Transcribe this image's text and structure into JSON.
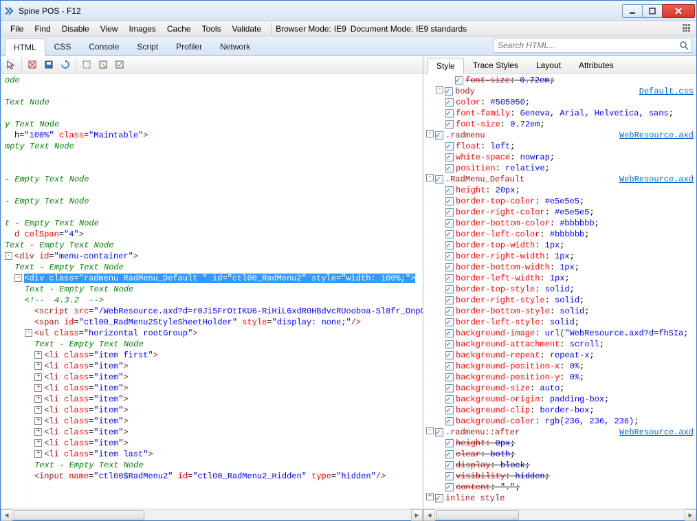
{
  "window": {
    "title": "Spine POS - F12"
  },
  "menubar": {
    "items": [
      "File",
      "Find",
      "Disable",
      "View",
      "Images",
      "Cache",
      "Tools",
      "Validate"
    ],
    "browser_mode_label": "Browser Mode:",
    "browser_mode_value": "IE9",
    "doc_mode_label": "Document Mode:",
    "doc_mode_value": "IE9 standards"
  },
  "tabs": {
    "items": [
      "HTML",
      "CSS",
      "Console",
      "Script",
      "Profiler",
      "Network"
    ],
    "active": "HTML",
    "search_placeholder": "Search HTML..."
  },
  "subtabs": {
    "items": [
      "Style",
      "Trace Styles",
      "Layout",
      "Attributes"
    ],
    "active": "Style"
  },
  "code_lines": [
    {
      "indent": 0,
      "type": "txt",
      "text": "ode"
    },
    {
      "indent": 0,
      "type": "blank"
    },
    {
      "indent": 0,
      "type": "txt",
      "text": "Text Node"
    },
    {
      "indent": 0,
      "type": "blank"
    },
    {
      "indent": 0,
      "type": "txt",
      "text": "y Text Node"
    },
    {
      "indent": 0,
      "type": "frag",
      "html": "h=<span class='c-val'>\"100%\"</span> <span class='c-attr'>class</span>=<span class='c-val'>\"Maintable\"</span><span class='c-tag'>&gt;</span>"
    },
    {
      "indent": 0,
      "type": "txt",
      "text": "mpty Text Node"
    },
    {
      "indent": 0,
      "type": "blank"
    },
    {
      "indent": 0,
      "type": "blank"
    },
    {
      "indent": 0,
      "type": "txt",
      "text": "- Empty Text Node"
    },
    {
      "indent": 0,
      "type": "blank"
    },
    {
      "indent": 0,
      "type": "txt",
      "text": "- Empty Text Node"
    },
    {
      "indent": 0,
      "type": "blank"
    },
    {
      "indent": 0,
      "type": "txt",
      "text": "t - Empty Text Node"
    },
    {
      "indent": 0,
      "type": "frag",
      "html": "<span class='c-tag'>d</span> <span class='c-attr'>colSpan</span>=<span class='c-val'>\"4\"</span><span class='c-tag'>&gt;</span>"
    },
    {
      "indent": 0,
      "type": "txt",
      "text": "Text - Empty Text Node"
    },
    {
      "indent": 0,
      "type": "frag",
      "twisty": "-",
      "html": "<span class='c-tag'>&lt;div</span> <span class='c-attr'>id</span>=<span class='c-val'>\"menu-container\"</span><span class='c-tag'>&gt;</span>"
    },
    {
      "indent": 1,
      "type": "txt",
      "text": "Text - Empty Text Node"
    },
    {
      "indent": 1,
      "type": "sel",
      "twisty": "-",
      "html": "&lt;div class=\"radmenu RadMenu_Default \" id=\"ctl00_RadMenu2\" style=\"width: 100%;\"&gt;"
    },
    {
      "indent": 2,
      "type": "txt",
      "text": "Text - Empty Text Node"
    },
    {
      "indent": 2,
      "type": "cm",
      "text": "<!--  4.3.2  -->"
    },
    {
      "indent": 2,
      "type": "frag",
      "html": "<span class='c-tag'>&lt;script</span> <span class='c-attr'>src</span>=<span class='c-val'>\"/WebResource.axd?d=r0Ji5FrOtIKU6-RiHiL6xdR0HBdvcRUooboa-Sl8fr_OnpC</span>"
    },
    {
      "indent": 2,
      "type": "frag",
      "html": "<span class='c-tag'>&lt;span</span> <span class='c-attr'>id</span>=<span class='c-val'>\"ctl00_RadMenu2StyleSheetHolder\"</span> <span class='c-attr'>style</span>=<span class='c-val'>\"display: none;\"</span><span class='c-tag'>/&gt;</span>"
    },
    {
      "indent": 2,
      "type": "frag",
      "twisty": "-",
      "html": "<span class='c-tag'>&lt;ul</span> <span class='c-attr'>class</span>=<span class='c-val'>\"horizontal rootGroup\"</span><span class='c-tag'>&gt;</span>"
    },
    {
      "indent": 3,
      "type": "txt",
      "text": "Text - Empty Text Node"
    },
    {
      "indent": 3,
      "type": "frag",
      "twisty": "+",
      "html": "<span class='c-tag'>&lt;li</span> <span class='c-attr'>class</span>=<span class='c-val'>\"item first\"</span><span class='c-tag'>&gt;</span>"
    },
    {
      "indent": 3,
      "type": "frag",
      "twisty": "+",
      "html": "<span class='c-tag'>&lt;li</span> <span class='c-attr'>class</span>=<span class='c-val'>\"item\"</span><span class='c-tag'>&gt;</span>"
    },
    {
      "indent": 3,
      "type": "frag",
      "twisty": "+",
      "html": "<span class='c-tag'>&lt;li</span> <span class='c-attr'>class</span>=<span class='c-val'>\"item\"</span><span class='c-tag'>&gt;</span>"
    },
    {
      "indent": 3,
      "type": "frag",
      "twisty": "+",
      "html": "<span class='c-tag'>&lt;li</span> <span class='c-attr'>class</span>=<span class='c-val'>\"item\"</span><span class='c-tag'>&gt;</span>"
    },
    {
      "indent": 3,
      "type": "frag",
      "twisty": "+",
      "html": "<span class='c-tag'>&lt;li</span> <span class='c-attr'>class</span>=<span class='c-val'>\"item\"</span><span class='c-tag'>&gt;</span>"
    },
    {
      "indent": 3,
      "type": "frag",
      "twisty": "+",
      "html": "<span class='c-tag'>&lt;li</span> <span class='c-attr'>class</span>=<span class='c-val'>\"item\"</span><span class='c-tag'>&gt;</span>"
    },
    {
      "indent": 3,
      "type": "frag",
      "twisty": "+",
      "html": "<span class='c-tag'>&lt;li</span> <span class='c-attr'>class</span>=<span class='c-val'>\"item\"</span><span class='c-tag'>&gt;</span>"
    },
    {
      "indent": 3,
      "type": "frag",
      "twisty": "+",
      "html": "<span class='c-tag'>&lt;li</span> <span class='c-attr'>class</span>=<span class='c-val'>\"item\"</span><span class='c-tag'>&gt;</span>"
    },
    {
      "indent": 3,
      "type": "frag",
      "twisty": "+",
      "html": "<span class='c-tag'>&lt;li</span> <span class='c-attr'>class</span>=<span class='c-val'>\"item\"</span><span class='c-tag'>&gt;</span>"
    },
    {
      "indent": 3,
      "type": "frag",
      "twisty": "+",
      "html": "<span class='c-tag'>&lt;li</span> <span class='c-attr'>class</span>=<span class='c-val'>\"item last\"</span><span class='c-tag'>&gt;</span>"
    },
    {
      "indent": 3,
      "type": "txt",
      "text": "Text - Empty Text Node"
    },
    {
      "indent": 2,
      "type": "frag",
      "html": "<span class='c-tag'>&lt;input</span> <span class='c-attr'>name</span>=<span class='c-val'>\"ctl00$RadMenu2\"</span> <span class='c-attr'>id</span>=<span class='c-val'>\"ctl00_RadMenu2_Hidden\"</span> <span class='c-attr'>type</span>=<span class='c-val'>\"hidden\"</span><span class='c-tag'>/&gt;</span>"
    }
  ],
  "style_rules": [
    {
      "indent": 3,
      "kind": "decl",
      "prop": "font-size",
      "val": "0.72em",
      "strike": true
    },
    {
      "indent": 1,
      "kind": "rule",
      "twisty": "-",
      "sel": "body",
      "src": "Default.css"
    },
    {
      "indent": 2,
      "kind": "decl",
      "prop": "color",
      "val": "#505050"
    },
    {
      "indent": 2,
      "kind": "decl",
      "prop": "font-family",
      "val": "Geneva, Arial, Helvetica, sans"
    },
    {
      "indent": 2,
      "kind": "decl",
      "prop": "font-size",
      "val": "0.72em"
    },
    {
      "indent": 0,
      "kind": "rule",
      "twisty": "-",
      "sel": ".radmenu",
      "src": "WebResource.axd"
    },
    {
      "indent": 2,
      "kind": "decl",
      "prop": "float",
      "val": "left"
    },
    {
      "indent": 2,
      "kind": "decl",
      "prop": "white-space",
      "val": "nowrap"
    },
    {
      "indent": 2,
      "kind": "decl",
      "prop": "position",
      "val": "relative"
    },
    {
      "indent": 0,
      "kind": "rule",
      "twisty": "-",
      "sel": ".RadMenu_Default",
      "src": "WebResource.axd"
    },
    {
      "indent": 2,
      "kind": "decl",
      "prop": "height",
      "val": "20px"
    },
    {
      "indent": 2,
      "kind": "decl",
      "prop": "border-top-color",
      "val": "#e5e5e5"
    },
    {
      "indent": 2,
      "kind": "decl",
      "prop": "border-right-color",
      "val": "#e5e5e5"
    },
    {
      "indent": 2,
      "kind": "decl",
      "prop": "border-bottom-color",
      "val": "#bbbbbb"
    },
    {
      "indent": 2,
      "kind": "decl",
      "prop": "border-left-color",
      "val": "#bbbbbb"
    },
    {
      "indent": 2,
      "kind": "decl",
      "prop": "border-top-width",
      "val": "1px"
    },
    {
      "indent": 2,
      "kind": "decl",
      "prop": "border-right-width",
      "val": "1px"
    },
    {
      "indent": 2,
      "kind": "decl",
      "prop": "border-bottom-width",
      "val": "1px"
    },
    {
      "indent": 2,
      "kind": "decl",
      "prop": "border-left-width",
      "val": "1px"
    },
    {
      "indent": 2,
      "kind": "decl",
      "prop": "border-top-style",
      "val": "solid"
    },
    {
      "indent": 2,
      "kind": "decl",
      "prop": "border-right-style",
      "val": "solid"
    },
    {
      "indent": 2,
      "kind": "decl",
      "prop": "border-bottom-style",
      "val": "solid"
    },
    {
      "indent": 2,
      "kind": "decl",
      "prop": "border-left-style",
      "val": "solid"
    },
    {
      "indent": 2,
      "kind": "decl",
      "prop": "background-image",
      "val": "url(\"WebResource.axd?d=fhSIa"
    },
    {
      "indent": 2,
      "kind": "decl",
      "prop": "background-attachment",
      "val": "scroll"
    },
    {
      "indent": 2,
      "kind": "decl",
      "prop": "background-repeat",
      "val": "repeat-x"
    },
    {
      "indent": 2,
      "kind": "decl",
      "prop": "background-position-x",
      "val": "0%"
    },
    {
      "indent": 2,
      "kind": "decl",
      "prop": "background-position-y",
      "val": "0%"
    },
    {
      "indent": 2,
      "kind": "decl",
      "prop": "background-size",
      "val": "auto"
    },
    {
      "indent": 2,
      "kind": "decl",
      "prop": "background-origin",
      "val": "padding-box"
    },
    {
      "indent": 2,
      "kind": "decl",
      "prop": "background-clip",
      "val": "border-box"
    },
    {
      "indent": 2,
      "kind": "decl",
      "prop": "background-color",
      "val": "rgb(236, 236, 236)"
    },
    {
      "indent": 0,
      "kind": "rule",
      "twisty": "-",
      "sel": ".radmenu::after",
      "src": "WebResource.axd"
    },
    {
      "indent": 2,
      "kind": "decl",
      "prop": "height",
      "val": "0px",
      "strike": true
    },
    {
      "indent": 2,
      "kind": "decl",
      "prop": "clear",
      "val": "both",
      "strike": true
    },
    {
      "indent": 2,
      "kind": "decl",
      "prop": "display",
      "val": "block",
      "strike": true
    },
    {
      "indent": 2,
      "kind": "decl",
      "prop": "visibility",
      "val": "hidden",
      "strike": true
    },
    {
      "indent": 2,
      "kind": "decl",
      "prop": "content",
      "val": "\".\"",
      "strike": true
    },
    {
      "indent": 0,
      "kind": "rule",
      "twisty": "+",
      "sel": "inline style"
    }
  ]
}
